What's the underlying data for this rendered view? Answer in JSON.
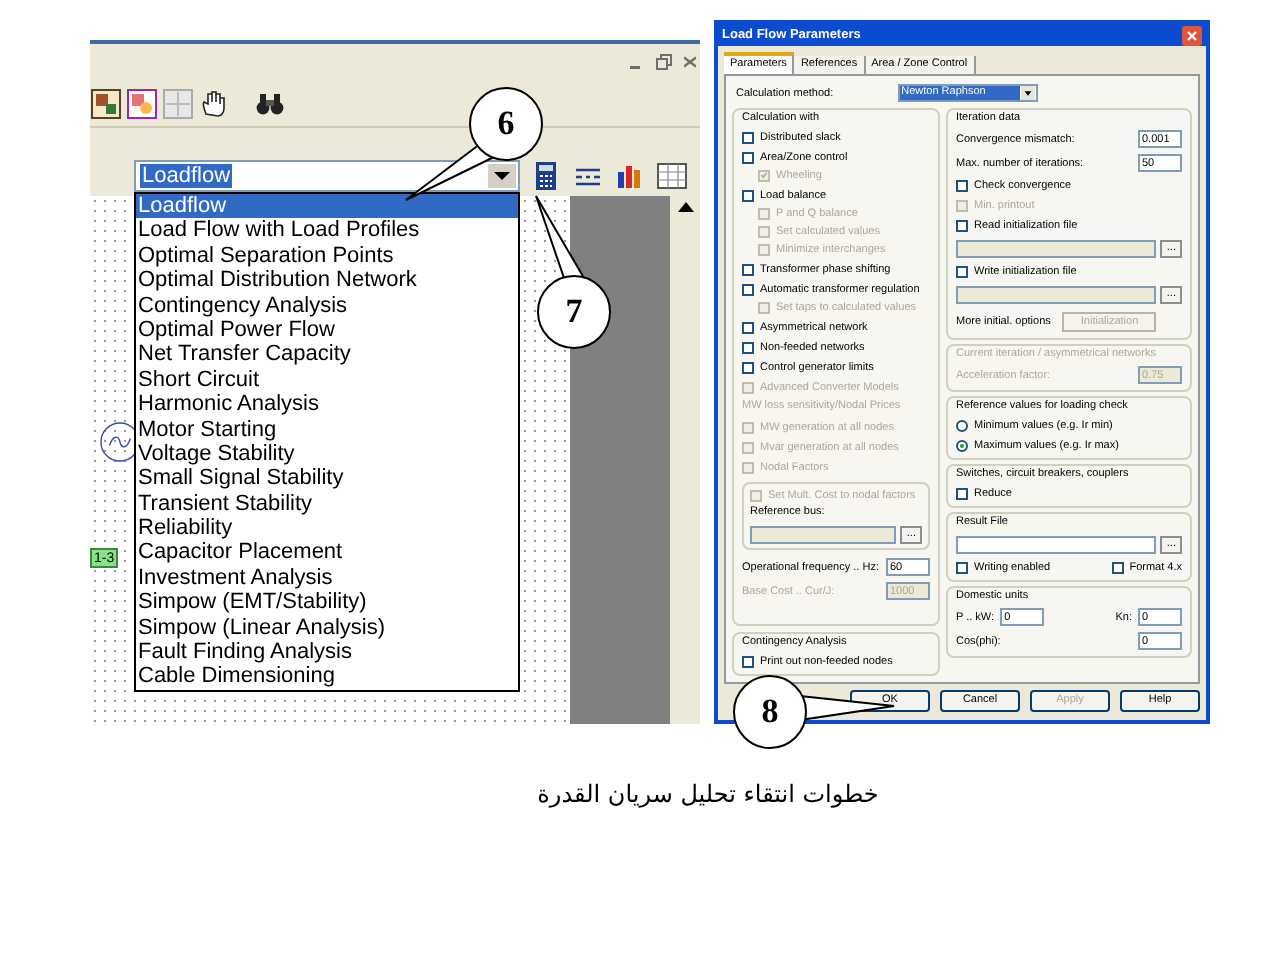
{
  "app_window": {
    "combo": {
      "value": "Loadflow"
    },
    "dropdown": {
      "items": [
        {
          "label": "Loadflow",
          "selected": true
        },
        {
          "label": "Load Flow with Load Profiles",
          "selected": false
        },
        {
          "label": "Optimal Separation Points",
          "selected": false
        },
        {
          "label": "Optimal Distribution Network",
          "selected": false
        },
        {
          "label": "Contingency Analysis",
          "selected": false
        },
        {
          "label": "Optimal Power Flow",
          "selected": false
        },
        {
          "label": "Net Transfer Capacity",
          "selected": false
        },
        {
          "label": "Short Circuit",
          "selected": false
        },
        {
          "label": "Harmonic Analysis",
          "selected": false
        },
        {
          "label": "Motor Starting",
          "selected": false
        },
        {
          "label": "Voltage Stability",
          "selected": false
        },
        {
          "label": "Small Signal Stability",
          "selected": false
        },
        {
          "label": "Transient Stability",
          "selected": false
        },
        {
          "label": "Reliability",
          "selected": false
        },
        {
          "label": "Capacitor Placement",
          "selected": false
        },
        {
          "label": "Investment Analysis",
          "selected": false
        },
        {
          "label": "Simpow (EMT/Stability)",
          "selected": false
        },
        {
          "label": "Simpow (Linear Analysis)",
          "selected": false
        },
        {
          "label": "Fault Finding Analysis",
          "selected": false
        },
        {
          "label": "Cable Dimensioning",
          "selected": false
        }
      ]
    },
    "canvas_tag": "1-3"
  },
  "callouts": [
    {
      "label": "6"
    },
    {
      "label": "7"
    },
    {
      "label": "8"
    }
  ],
  "dialog": {
    "title": "Load Flow Parameters",
    "tabs": [
      {
        "label": "Parameters",
        "selected": true
      },
      {
        "label": "References",
        "selected": false
      },
      {
        "label": "Area / Zone Control",
        "selected": false
      }
    ],
    "method": {
      "label": "Calculation method:",
      "value": "Newton Raphson"
    },
    "left_groups": [
      {
        "title": "Calculation with",
        "disabled": false,
        "items": [
          {
            "kind": "checkbox",
            "label": "Distributed slack",
            "checked": false,
            "disabled": false
          },
          {
            "kind": "checkbox",
            "label": "Area/Zone control",
            "checked": false,
            "disabled": false,
            "children": [
              {
                "kind": "checkbox",
                "label": "Wheeling",
                "checked": true,
                "disabled": true
              }
            ]
          },
          {
            "kind": "checkbox",
            "label": "Load balance",
            "checked": false,
            "disabled": false,
            "children": [
              {
                "kind": "checkbox",
                "label": "P and Q balance",
                "checked": false,
                "disabled": true
              },
              {
                "kind": "checkbox",
                "label": "Set calculated values",
                "checked": false,
                "disabled": true
              },
              {
                "kind": "checkbox",
                "label": "Minimize interchanges",
                "checked": false,
                "disabled": true
              }
            ]
          },
          {
            "kind": "checkbox",
            "label": "Transformer phase shifting",
            "checked": false,
            "disabled": false
          },
          {
            "kind": "checkbox",
            "label": "Automatic transformer regulation",
            "checked": false,
            "disabled": false,
            "children": [
              {
                "kind": "checkbox",
                "label": "Set taps to calculated values",
                "checked": false,
                "disabled": true
              }
            ]
          },
          {
            "kind": "checkbox",
            "label": "Asymmetrical network",
            "checked": false,
            "disabled": false
          },
          {
            "kind": "checkbox",
            "label": "Non-feeded networks",
            "checked": false,
            "disabled": false
          },
          {
            "kind": "checkbox",
            "label": "Control generator limits",
            "checked": false,
            "disabled": false
          },
          {
            "kind": "checkbox",
            "label": "Advanced Converter Models",
            "checked": false,
            "disabled": true
          },
          {
            "kind": "note",
            "label": "MW loss sensitivity/Nodal Prices",
            "disabled": true
          },
          {
            "kind": "checkbox",
            "label": "MW generation at all nodes",
            "checked": false,
            "disabled": true
          },
          {
            "kind": "checkbox",
            "label": "Mvar generation at all nodes",
            "checked": false,
            "disabled": true
          },
          {
            "kind": "checkbox",
            "label": "Nodal Factors",
            "checked": false,
            "disabled": true
          },
          {
            "kind": "subgroup",
            "items": [
              {
                "kind": "checkbox",
                "label": "Set Mult. Cost to nodal factors",
                "checked": false,
                "disabled": true
              },
              {
                "kind": "note",
                "label": "Reference bus:",
                "disabled": false
              },
              {
                "kind": "browse",
                "button": "...",
                "disabled": true
              }
            ]
          },
          {
            "kind": "field",
            "label": "Operational frequency .. Hz:",
            "value": "60",
            "disabled": false
          },
          {
            "kind": "field",
            "label": "Base Cost .. Cur/J:",
            "value": "1000",
            "disabled": true
          }
        ]
      },
      {
        "title": "Contingency Analysis",
        "disabled": false,
        "items": [
          {
            "kind": "checkbox",
            "label": "Print out non-feeded nodes",
            "checked": false,
            "disabled": false
          }
        ]
      }
    ],
    "right_groups": [
      {
        "title": "Iteration data",
        "disabled": false,
        "items": [
          {
            "kind": "field",
            "label": "Convergence mismatch:",
            "value": "0.001",
            "disabled": false
          },
          {
            "kind": "field",
            "label": "Max. number of iterations:",
            "value": "50",
            "disabled": false
          },
          {
            "kind": "checkbox",
            "label": "Check convergence",
            "checked": false,
            "disabled": false
          },
          {
            "kind": "checkbox",
            "label": "Min. printout",
            "checked": false,
            "disabled": true
          },
          {
            "kind": "checkbox",
            "label": "Read initialization file",
            "checked": false,
            "disabled": false
          },
          {
            "kind": "browse",
            "button": "...",
            "disabled": true
          },
          {
            "kind": "checkbox",
            "label": "Write initialization file",
            "checked": false,
            "disabled": false
          },
          {
            "kind": "browse",
            "button": "...",
            "disabled": true
          },
          {
            "kind": "action",
            "label": "More initial. options",
            "button": "Initialization",
            "disabled": true
          }
        ]
      },
      {
        "title": "Current iteration / asymmetrical networks",
        "disabled": true,
        "items": [
          {
            "kind": "field",
            "label": "Acceleration factor:",
            "value": "0.75",
            "disabled": true
          }
        ]
      },
      {
        "title": "Reference values for loading check",
        "disabled": false,
        "items": [
          {
            "kind": "radio",
            "label": "Minimum values (e.g. Ir min)",
            "selected": false
          },
          {
            "kind": "radio",
            "label": "Maximum values (e.g. Ir max)",
            "selected": true
          }
        ]
      },
      {
        "title": "Switches, circuit breakers, couplers",
        "disabled": false,
        "items": [
          {
            "kind": "checkbox",
            "label": "Reduce",
            "checked": false,
            "disabled": false
          }
        ]
      },
      {
        "title": "Result File",
        "disabled": false,
        "items": [
          {
            "kind": "browse",
            "button": "...",
            "disabled": false
          },
          {
            "kind": "row",
            "items": [
              {
                "kind": "checkbox",
                "label": "Writing enabled",
                "checked": false,
                "disabled": false
              },
              {
                "kind": "checkbox",
                "label": "Format 4.x",
                "checked": false,
                "disabled": false
              }
            ]
          }
        ]
      },
      {
        "title": "Domestic units",
        "disabled": false,
        "items": [
          {
            "kind": "row",
            "items": [
              {
                "kind": "field",
                "label": "P .. kW:",
                "value": "0",
                "disabled": false
              },
              {
                "kind": "field",
                "label": "Kn:",
                "value": "0",
                "disabled": false
              }
            ]
          },
          {
            "kind": "field",
            "label": "Cos(phi):",
            "value": "0",
            "disabled": false
          }
        ]
      }
    ],
    "buttons": [
      {
        "label": "OK",
        "disabled": false
      },
      {
        "label": "Cancel",
        "disabled": false
      },
      {
        "label": "Apply",
        "disabled": true
      },
      {
        "label": "Help",
        "disabled": false
      }
    ]
  },
  "caption": "خطوات انتقاء تحليل سريان القدرة"
}
